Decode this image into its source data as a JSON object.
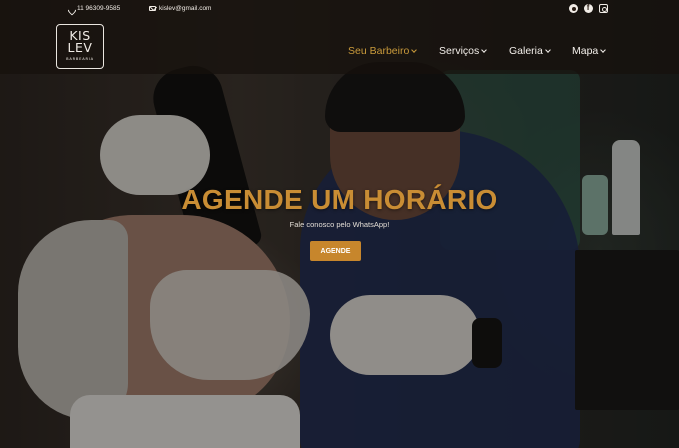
{
  "topbar": {
    "phone": "11 96309-9585",
    "email": "kislev@gmail.com"
  },
  "logo": {
    "line1": "KIS",
    "line2": "LEV",
    "subtitle": "BARBEARIA"
  },
  "nav": {
    "items": [
      {
        "label": "Seu Barbeiro",
        "active": true
      },
      {
        "label": "Serviços"
      },
      {
        "label": "Galeria"
      },
      {
        "label": "Mapa"
      }
    ]
  },
  "hero": {
    "title": "AGENDE UM HORÁRIO",
    "subtitle": "Fale conosco pelo WhatsApp!",
    "cta_label": "AGENDE"
  },
  "social": [
    "whatsapp-icon",
    "facebook-icon",
    "instagram-icon"
  ],
  "colors": {
    "accent": "#c98d34",
    "button": "#c7862c",
    "nav_active": "#c99a3b"
  }
}
